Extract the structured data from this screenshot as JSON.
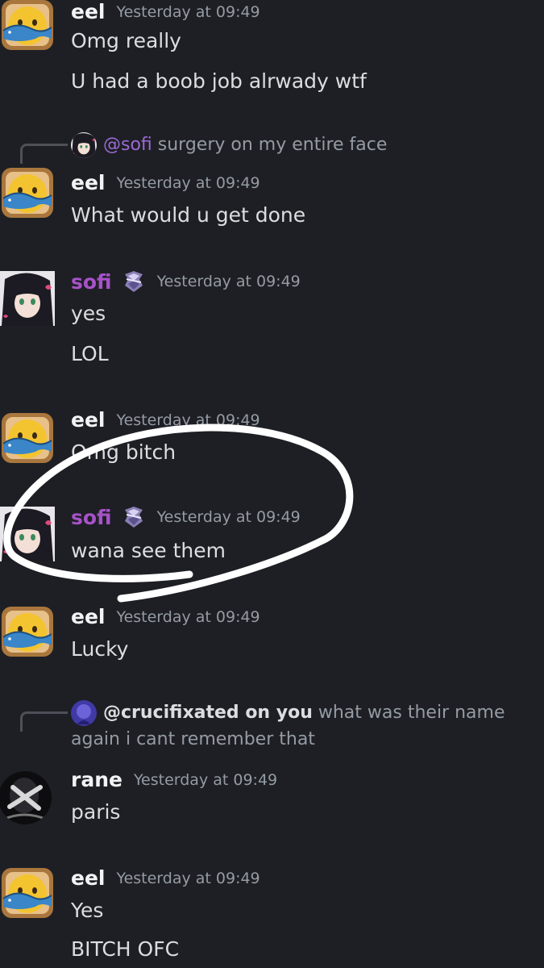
{
  "messages": [
    {
      "user": "eel",
      "time": "Yesterday at 09:49",
      "lines": [
        "Omg really",
        "U had a boob job alrwady wtf"
      ]
    },
    {
      "reply": {
        "mention": "@sofi",
        "text": "surgery on my entire face"
      },
      "user": "eel",
      "time": "Yesterday at 09:49",
      "lines": [
        "What would u get done"
      ]
    },
    {
      "user": "sofi",
      "time": "Yesterday at 09:49",
      "lines": [
        "yes",
        "LOL"
      ]
    },
    {
      "user": "eel",
      "time": "Yesterday at 09:49",
      "lines": [
        "Omg bitch"
      ]
    },
    {
      "user": "sofi",
      "time": "Yesterday at 09:49",
      "lines": [
        "wana see them"
      ]
    },
    {
      "user": "eel",
      "time": "Yesterday at 09:49",
      "lines": [
        "Lucky"
      ]
    },
    {
      "reply": {
        "mention": "@crucifixated on you",
        "text": "what was their name",
        "text2": "again i cant remember that"
      },
      "user": "rane",
      "time": "Yesterday at 09:49",
      "lines": [
        "paris"
      ]
    },
    {
      "user": "eel",
      "time": "Yesterday at 09:49",
      "lines": [
        "Yes",
        "BITCH OFC"
      ]
    }
  ],
  "icons": {
    "eel_avatar": "toast-fish-face-icon",
    "sofi_avatar": "anime-girl-avatar",
    "sofi_badge": "crystal-badge-icon",
    "rane_avatar": "dark-portrait-avatar",
    "reply_crucifixated_avatar": "purple-avatar"
  },
  "colors": {
    "background": "#1e1f24",
    "sofi_name": "#a652c9",
    "mention": "#9a6ad6",
    "timestamp": "#949ba4"
  }
}
